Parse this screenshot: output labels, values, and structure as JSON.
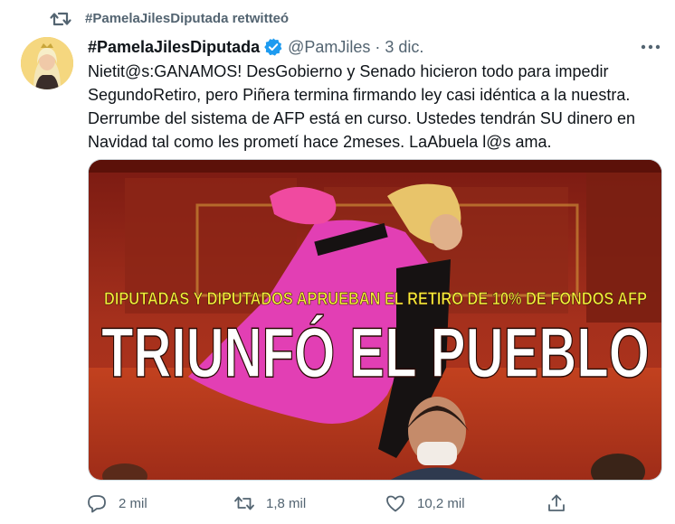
{
  "retweet": {
    "icon": "retweet-icon",
    "text": "#PamelaJilesDiputada retwitteó"
  },
  "author": {
    "name": "#PamelaJilesDiputada",
    "verified_icon": "verified-badge-icon",
    "handle": "@PamJiles",
    "separator": "·",
    "time": "3 dic."
  },
  "tweet": {
    "lines": [
      "Nietit@s:GANAMOS! DesGobierno y Senado hicieron todo para impedir",
      "SegundoRetiro, pero Piñera termina firmando ley casi idéntica a la nuestra.",
      "Derrumbe del sistema de AFP está en curso. Ustedes tendrán SU dinero en",
      "Navidad tal como les prometí hace 2meses. LaAbuela l@s ama."
    ]
  },
  "media": {
    "headline_small": "DIPUTADAS Y DIPUTADOS APRUEBAN EL RETIRO DE 10% DE FONDOS AFP",
    "headline_big": "TRIUNFÓ EL PUEBLO"
  },
  "actions": {
    "reply": {
      "icon": "reply-icon",
      "count": "2 mil"
    },
    "retweet": {
      "icon": "retweet-icon",
      "count": "1,8 mil"
    },
    "like": {
      "icon": "heart-icon",
      "count": "10,2 mil"
    },
    "share": {
      "icon": "share-icon"
    }
  },
  "colors": {
    "verified_blue": "#1d9bf0",
    "secondary_text": "#536471",
    "headline_yellow": "#f4ee3a",
    "pink": "#e23fb4"
  }
}
